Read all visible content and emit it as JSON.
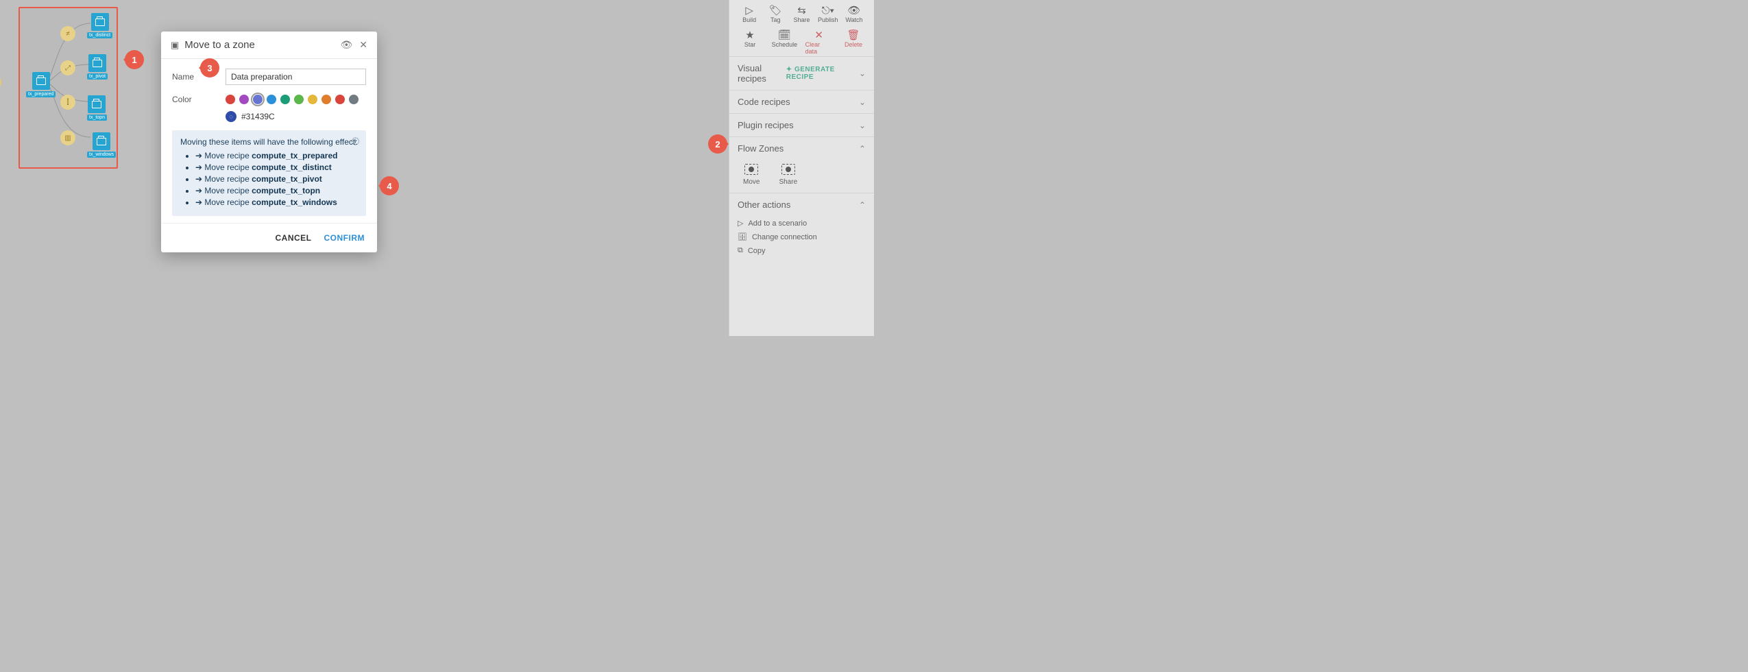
{
  "canvas": {
    "dataset_root": "tx_prepared",
    "datasets": [
      "tx_distinct",
      "tx_pivot",
      "tx_topn",
      "tx_windows"
    ]
  },
  "rightPanel": {
    "actions1": [
      {
        "name": "build",
        "label": "Build"
      },
      {
        "name": "tag",
        "label": "Tag"
      },
      {
        "name": "share",
        "label": "Share"
      },
      {
        "name": "publish",
        "label": "Publish"
      },
      {
        "name": "watch",
        "label": "Watch"
      }
    ],
    "actions2": [
      {
        "name": "star",
        "label": "Star"
      },
      {
        "name": "schedule",
        "label": "Schedule"
      },
      {
        "name": "cleardata",
        "label": "Clear data",
        "red": true
      },
      {
        "name": "delete",
        "label": "Delete",
        "red": true
      }
    ],
    "sections": {
      "visual_recipes": "Visual recipes",
      "generate": "GENERATE RECIPE",
      "code_recipes": "Code recipes",
      "plugin_recipes": "Plugin recipes",
      "flow_zones": "Flow Zones",
      "move": "Move",
      "share": "Share",
      "other_actions": "Other actions",
      "other_list": [
        "Add to a scenario",
        "Change connection",
        "Copy"
      ]
    }
  },
  "modal": {
    "title": "Move to a zone",
    "name_label": "Name",
    "name_value": "Data preparation",
    "color_label": "Color",
    "hex": "#31439C",
    "swatches": [
      "#d9443d",
      "#a24bc1",
      "#6874d1",
      "#2c8fd9",
      "#1b9e77",
      "#5cb74b",
      "#e5b83d",
      "#e07e2e",
      "#d9443d",
      "#727a82"
    ],
    "selected_swatch": 2,
    "effect_intro": "Moving these items will have the following effect:",
    "effects": [
      {
        "pre": "Move recipe ",
        "b": "compute_tx_prepared"
      },
      {
        "pre": "Move recipe ",
        "b": "compute_tx_distinct"
      },
      {
        "pre": "Move recipe ",
        "b": "compute_tx_pivot"
      },
      {
        "pre": "Move recipe ",
        "b": "compute_tx_topn"
      },
      {
        "pre": "Move recipe ",
        "b": "compute_tx_windows"
      }
    ],
    "cancel": "CANCEL",
    "confirm": "CONFIRM"
  },
  "callouts": [
    "1",
    "2",
    "3",
    "4"
  ]
}
